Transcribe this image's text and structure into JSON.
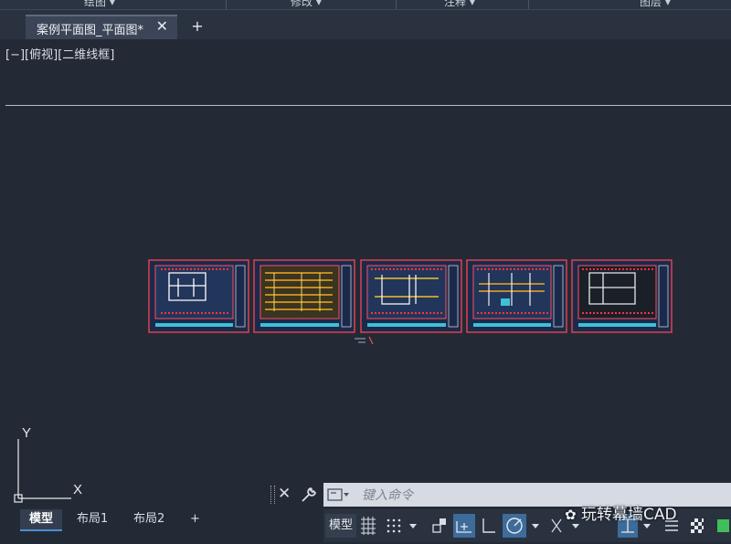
{
  "ribbon": {
    "panels": [
      {
        "label": "绘图 ▾"
      },
      {
        "label": "修改 ▾"
      },
      {
        "label": "注释 ▾"
      },
      {
        "label": "图层 ▾"
      }
    ]
  },
  "tabs": {
    "document_tab": "案例平面图_平面图*",
    "close_glyph": "✕",
    "new_tab_glyph": "+"
  },
  "viewport": {
    "controls": {
      "viewport_menu": "[−]",
      "view_name": "[俯视]",
      "visual_style": "[二维线框]"
    },
    "ucs": {
      "x_label": "X",
      "y_label": "Y"
    },
    "background_color": "#232a35"
  },
  "command_line": {
    "close_glyph": "✕",
    "placeholder": "键入命令"
  },
  "layout_tabs": {
    "items": [
      "模型",
      "布局1",
      "布局2"
    ],
    "active": "模型",
    "add_glyph": "+"
  },
  "statusbar": {
    "model_label": "模型"
  },
  "watermark": {
    "text": "玩转幕墙CAD"
  },
  "colors": {
    "accent": "#4a8fd6",
    "sheet_border": "#b01f2e",
    "sheet_fill": "#1b2a4a",
    "sheet_outline": "#e04050"
  }
}
